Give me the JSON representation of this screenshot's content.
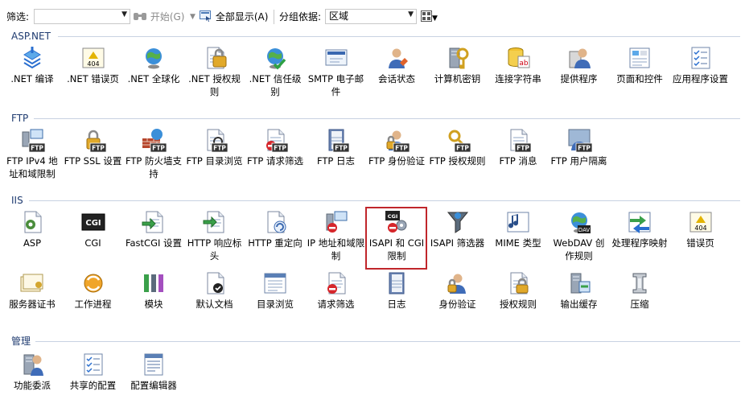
{
  "toolbar": {
    "filter_label": "筛选:",
    "filter_value": "",
    "start_label": "开始(G)",
    "show_all_label": "全部显示(A)",
    "group_by_label": "分组依据:",
    "group_by_value": "区域"
  },
  "sections": [
    {
      "title": "ASP.NET",
      "items": [
        {
          "label": ".NET 编译",
          "icon": "compile-icon"
        },
        {
          "label": ".NET 错误页",
          "icon": "error-page-icon"
        },
        {
          "label": ".NET 全球化",
          "icon": "globe-icon"
        },
        {
          "label": ".NET 授权规则",
          "icon": "auth-rules-icon"
        },
        {
          "label": ".NET 信任级别",
          "icon": "trust-level-icon"
        },
        {
          "label": "SMTP 电子邮件",
          "icon": "smtp-icon"
        },
        {
          "label": "会话状态",
          "icon": "session-state-icon"
        },
        {
          "label": "计算机密钥",
          "icon": "machine-key-icon"
        },
        {
          "label": "连接字符串",
          "icon": "connection-string-icon"
        },
        {
          "label": "提供程序",
          "icon": "providers-icon"
        },
        {
          "label": "页面和控件",
          "icon": "pages-controls-icon"
        },
        {
          "label": "应用程序设置",
          "icon": "app-settings-icon"
        }
      ]
    },
    {
      "title": "FTP",
      "items": [
        {
          "label": "FTP IPv4 地址和域限制",
          "icon": "ftp-ip-icon"
        },
        {
          "label": "FTP SSL 设置",
          "icon": "ftp-ssl-icon"
        },
        {
          "label": "FTP 防火墙支持",
          "icon": "ftp-firewall-icon"
        },
        {
          "label": "FTP 目录浏览",
          "icon": "ftp-directory-icon"
        },
        {
          "label": "FTP 请求筛选",
          "icon": "ftp-request-filter-icon"
        },
        {
          "label": "FTP 日志",
          "icon": "ftp-log-icon"
        },
        {
          "label": "FTP 身份验证",
          "icon": "ftp-authentication-icon"
        },
        {
          "label": "FTP 授权规则",
          "icon": "ftp-authorization-icon"
        },
        {
          "label": "FTP 消息",
          "icon": "ftp-messages-icon"
        },
        {
          "label": "FTP 用户隔离",
          "icon": "ftp-user-isolation-icon"
        }
      ]
    },
    {
      "title": "IIS",
      "items": [
        {
          "label": "ASP",
          "icon": "asp-icon"
        },
        {
          "label": "CGI",
          "icon": "cgi-icon"
        },
        {
          "label": "FastCGI 设置",
          "icon": "fastcgi-icon"
        },
        {
          "label": "HTTP 响应标头",
          "icon": "http-headers-icon"
        },
        {
          "label": "HTTP 重定向",
          "icon": "http-redirect-icon"
        },
        {
          "label": "IP 地址和域限制",
          "icon": "ip-restrictions-icon"
        },
        {
          "label": "ISAPI 和 CGI 限制",
          "icon": "isapi-cgi-icon"
        },
        {
          "label": "ISAPI 筛选器",
          "icon": "isapi-filters-icon"
        },
        {
          "label": "MIME 类型",
          "icon": "mime-types-icon"
        },
        {
          "label": "WebDAV 创作规则",
          "icon": "webdav-icon"
        },
        {
          "label": "处理程序映射",
          "icon": "handler-mappings-icon"
        },
        {
          "label": "错误页",
          "icon": "error-pages-icon"
        },
        {
          "label": "服务器证书",
          "icon": "certificates-icon"
        },
        {
          "label": "工作进程",
          "icon": "worker-process-icon"
        },
        {
          "label": "模块",
          "icon": "modules-icon"
        },
        {
          "label": "默认文档",
          "icon": "default-document-icon"
        },
        {
          "label": "目录浏览",
          "icon": "directory-browsing-icon"
        },
        {
          "label": "请求筛选",
          "icon": "request-filtering-icon"
        },
        {
          "label": "日志",
          "icon": "logging-icon"
        },
        {
          "label": "身份验证",
          "icon": "authentication-icon"
        },
        {
          "label": "授权规则",
          "icon": "authorization-icon"
        },
        {
          "label": "输出缓存",
          "icon": "output-caching-icon"
        },
        {
          "label": "压缩",
          "icon": "compression-icon"
        }
      ]
    },
    {
      "title": "管理",
      "items": [
        {
          "label": "功能委派",
          "icon": "feature-delegation-icon"
        },
        {
          "label": "共享的配置",
          "icon": "shared-config-icon"
        },
        {
          "label": "配置编辑器",
          "icon": "config-editor-icon"
        }
      ]
    }
  ],
  "badges": {
    "ftp": "FTP",
    "cgi": "CGI",
    "error": "404",
    "dav": "DAV",
    "ab": "ab"
  },
  "colors": {
    "section_title": "#1f3b70",
    "selection": "#c0262b",
    "accent_blue": "#2a6fd0"
  }
}
